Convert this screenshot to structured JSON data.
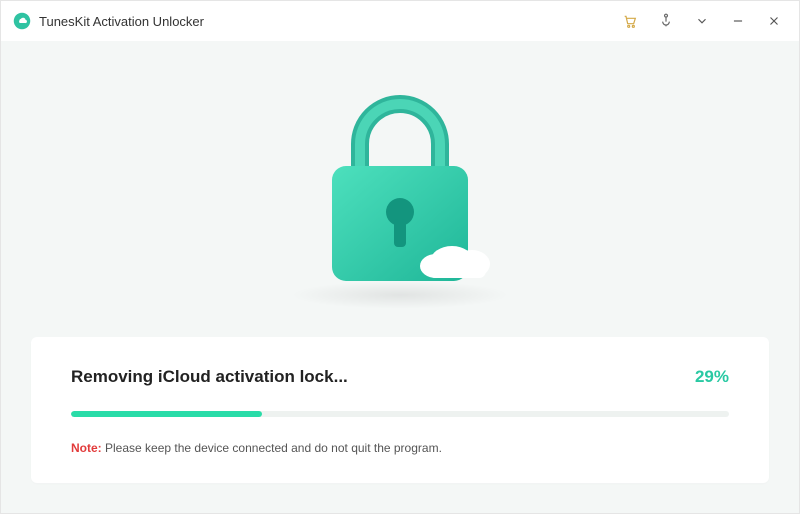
{
  "titlebar": {
    "app_title": "TunesKit Activation Unlocker",
    "icons": {
      "cart": "cart-icon",
      "help": "help-icon",
      "dropdown": "chevron-down-icon",
      "minimize": "minimize-icon",
      "close": "close-icon"
    }
  },
  "illustration": {
    "name": "lock-cloud-illustration"
  },
  "progress": {
    "title": "Removing iCloud activation lock...",
    "percent_label": "29%",
    "percent_value": 29,
    "percent_width_style": "width:29%"
  },
  "note": {
    "label": "Note:",
    "text": " Please keep the device connected and do not quit the program."
  },
  "colors": {
    "accent": "#29dca8",
    "accent_text": "#29c9a3",
    "note_red": "#e23b3b"
  }
}
